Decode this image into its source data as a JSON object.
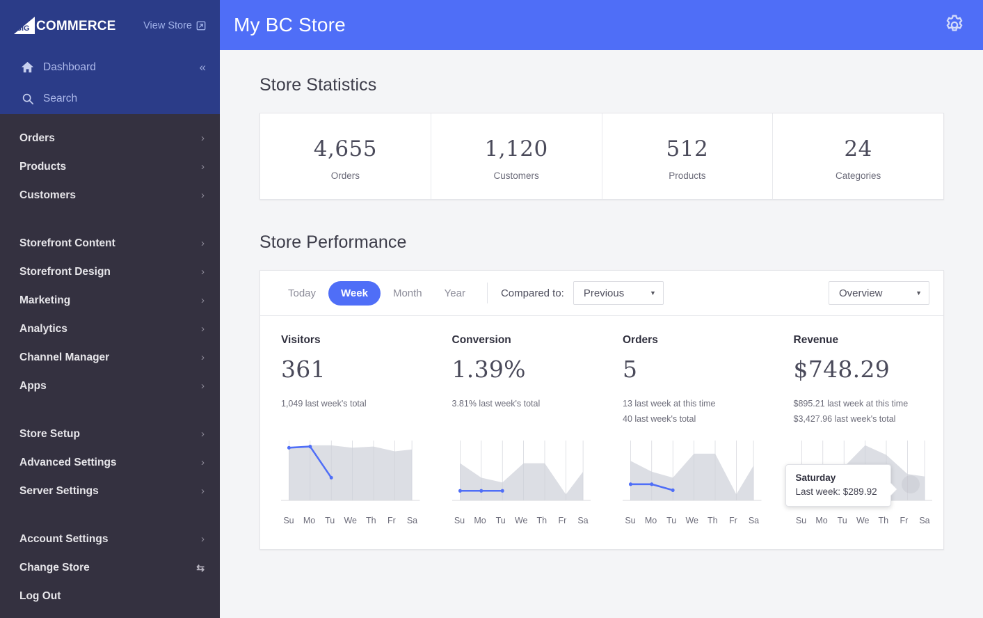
{
  "sidebar": {
    "brand": {
      "logo_text": "COMMERCE",
      "logo_icon": "bigcommerce-logo-icon"
    },
    "view_store": {
      "label": "View Store",
      "icon": "external-link-icon"
    },
    "dashboard": {
      "label": "Dashboard",
      "icon": "home-icon",
      "collapse_icon": "chevron-double-left-icon"
    },
    "search": {
      "label": "Search",
      "icon": "search-icon"
    },
    "groups": [
      {
        "items": [
          {
            "label": "Orders",
            "trailing": "chevron-right-icon"
          },
          {
            "label": "Products",
            "trailing": "chevron-right-icon"
          },
          {
            "label": "Customers",
            "trailing": "chevron-right-icon"
          }
        ]
      },
      {
        "items": [
          {
            "label": "Storefront Content",
            "trailing": "chevron-right-icon"
          },
          {
            "label": "Storefront Design",
            "trailing": "chevron-right-icon"
          },
          {
            "label": "Marketing",
            "trailing": "chevron-right-icon"
          },
          {
            "label": "Analytics",
            "trailing": "chevron-right-icon"
          },
          {
            "label": "Channel Manager",
            "trailing": "chevron-right-icon"
          },
          {
            "label": "Apps",
            "trailing": "chevron-right-icon"
          }
        ]
      },
      {
        "items": [
          {
            "label": "Store Setup",
            "trailing": "chevron-right-icon"
          },
          {
            "label": "Advanced Settings",
            "trailing": "chevron-right-icon"
          },
          {
            "label": "Server Settings",
            "trailing": "chevron-right-icon"
          }
        ]
      },
      {
        "items": [
          {
            "label": "Account Settings",
            "trailing": "chevron-right-icon"
          },
          {
            "label": "Change Store",
            "trailing": "swap-arrows-icon"
          },
          {
            "label": "Log Out",
            "trailing": ""
          }
        ]
      }
    ]
  },
  "topbar": {
    "store_title": "My BC Store",
    "settings_icon": "gear-icon"
  },
  "store_statistics": {
    "heading": "Store Statistics",
    "cards": [
      {
        "value": "4,655",
        "label": "Orders"
      },
      {
        "value": "1,120",
        "label": "Customers"
      },
      {
        "value": "512",
        "label": "Products"
      },
      {
        "value": "24",
        "label": "Categories"
      }
    ]
  },
  "store_performance": {
    "heading": "Store Performance",
    "range_tabs": [
      {
        "label": "Today",
        "active": false
      },
      {
        "label": "Week",
        "active": true
      },
      {
        "label": "Month",
        "active": false
      },
      {
        "label": "Year",
        "active": false
      }
    ],
    "compared_to_label": "Compared to:",
    "compared_to_value": "Previous",
    "view_select_value": "Overview",
    "metrics": [
      {
        "title": "Visitors",
        "value": "361",
        "subs": [
          "1,049 last week's total"
        ]
      },
      {
        "title": "Conversion",
        "value": "1.39%",
        "subs": [
          "3.81% last week's total"
        ]
      },
      {
        "title": "Orders",
        "value": "5",
        "subs": [
          "13 last week at this time",
          "40 last week's total"
        ]
      },
      {
        "title": "Revenue",
        "value": "$748.29",
        "subs": [
          "$895.21 last week at this time",
          "$3,427.96 last week's total"
        ]
      }
    ],
    "tooltip": {
      "title": "Saturday",
      "line": "Last week: $289.92"
    },
    "colors": {
      "accent": "#4f6ef7",
      "area": "#dcdee4",
      "sidebar": "#343140",
      "sidebar_top": "#2b3c88"
    }
  },
  "chart_data": [
    {
      "type": "area",
      "title": "Visitors",
      "categories": [
        "Su",
        "Mo",
        "Tu",
        "We",
        "Th",
        "Fr",
        "Sa"
      ],
      "series": [
        {
          "name": "Last week",
          "values": [
            86,
            92,
            92,
            88,
            90,
            82,
            85
          ],
          "style": "area"
        },
        {
          "name": "This week",
          "values": [
            88,
            90,
            38,
            null,
            null,
            null,
            null
          ],
          "style": "line"
        }
      ],
      "ylim": [
        0,
        100
      ],
      "grid": true,
      "legend": false
    },
    {
      "type": "area",
      "title": "Conversion",
      "categories": [
        "Su",
        "Mo",
        "Tu",
        "We",
        "Th",
        "Fr",
        "Sa"
      ],
      "series": [
        {
          "name": "Last week",
          "values": [
            62,
            38,
            30,
            62,
            62,
            10,
            48
          ],
          "style": "area"
        },
        {
          "name": "This week",
          "values": [
            16,
            16,
            16,
            null,
            null,
            null,
            null
          ],
          "style": "line"
        }
      ],
      "ylim": [
        0,
        100
      ],
      "grid": true,
      "legend": false
    },
    {
      "type": "area",
      "title": "Orders",
      "categories": [
        "Su",
        "Mo",
        "Tu",
        "We",
        "Th",
        "Fr",
        "Sa"
      ],
      "series": [
        {
          "name": "Last week",
          "values": [
            66,
            48,
            38,
            78,
            78,
            10,
            58
          ],
          "style": "area"
        },
        {
          "name": "This week",
          "values": [
            27,
            27,
            17,
            null,
            null,
            null,
            null
          ],
          "style": "line"
        }
      ],
      "ylim": [
        0,
        100
      ],
      "grid": true,
      "legend": false
    },
    {
      "type": "area",
      "title": "Revenue",
      "categories": [
        "Su",
        "Mo",
        "Tu",
        "We",
        "Th",
        "Fr",
        "Sa"
      ],
      "series": [
        {
          "name": "Last week",
          "values": [
            46,
            36,
            56,
            92,
            76,
            44,
            40
          ],
          "style": "area"
        },
        {
          "name": "This week",
          "values": [
            30,
            26,
            20,
            null,
            null,
            null,
            null
          ],
          "style": "line"
        }
      ],
      "ylim": [
        0,
        100
      ],
      "grid": true,
      "legend": false,
      "annotation": {
        "label": "Saturday",
        "text": "Last week: $289.92",
        "point": "Sa"
      }
    }
  ]
}
